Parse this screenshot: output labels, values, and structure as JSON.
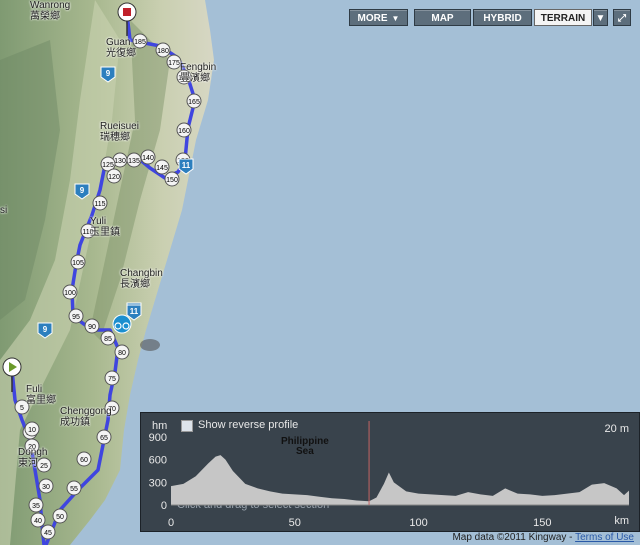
{
  "controls": {
    "more": "MORE",
    "map": "MAP",
    "hybrid": "HYBRID",
    "terrain": "TERRAIN",
    "active": "terrain"
  },
  "places": [
    {
      "id": "wanrong",
      "name": "Wanrong",
      "zh": "萬榮鄉"
    },
    {
      "id": "guanfu",
      "name": "Guan",
      "zh": "光復鄉"
    },
    {
      "id": "fengbin",
      "name": "Fengbin",
      "zh": "豐濱鄉"
    },
    {
      "id": "ruisui",
      "name": "Rueisuei",
      "zh": "瑞穗鄉"
    },
    {
      "id": "yuli",
      "name": "Yuli",
      "zh": "玉里鎮"
    },
    {
      "id": "changbin",
      "name": "Changbin",
      "zh": "長濱鄉"
    },
    {
      "id": "fuli",
      "name": "Fuli",
      "zh": "富里鄉"
    },
    {
      "id": "chenggong",
      "name": "Chenggong",
      "zh": "成功鎮"
    },
    {
      "id": "donghe",
      "name": "Dongh",
      "zh": "東河"
    },
    {
      "id": "edge_si",
      "name": "si",
      "zh": ""
    }
  ],
  "route_markers": [
    "185",
    "180",
    "175",
    "170",
    "165",
    "160",
    "155",
    "150",
    "145",
    "140",
    "135",
    "130",
    "125",
    "120",
    "115",
    "110",
    "105",
    "100",
    "95",
    "90",
    "85",
    "80",
    "75",
    "70",
    "65",
    "60",
    "55",
    "50",
    "45",
    "40",
    "35",
    "30",
    "25",
    "20",
    "15",
    "10",
    "5"
  ],
  "road_shields": [
    "9",
    "9",
    "9",
    "9",
    "11",
    "11"
  ],
  "sea_label": [
    "Philippine",
    "Sea"
  ],
  "elevation": {
    "unit_y": "hm",
    "unit_x": "km",
    "scale_label": "20 m",
    "show_reverse_label": "Show reverse profile",
    "hint": "Click and drag to select section",
    "colors": {
      "fill": "#c6c6c6",
      "bg": "#303840"
    }
  },
  "chart_data": {
    "type": "area",
    "title": "",
    "xlabel": "km",
    "ylabel": "hm",
    "xlim": [
      0,
      185
    ],
    "ylim": [
      0,
      900
    ],
    "x_ticks": [
      0,
      50,
      100,
      150
    ],
    "y_ticks": [
      0,
      300,
      600,
      900
    ],
    "series": [
      {
        "x": [
          0,
          5,
          10,
          15,
          18,
          20,
          22,
          25,
          30,
          35,
          40,
          45,
          50,
          55,
          60,
          65,
          70,
          75,
          80,
          83,
          86,
          88,
          90,
          95,
          100,
          105,
          110,
          115,
          120,
          125,
          130,
          135,
          140,
          145,
          150,
          155,
          160,
          165,
          170,
          175,
          180,
          183,
          185
        ],
        "values": [
          250,
          280,
          380,
          550,
          640,
          660,
          600,
          450,
          280,
          220,
          180,
          150,
          140,
          130,
          110,
          90,
          80,
          60,
          50,
          100,
          280,
          430,
          300,
          180,
          150,
          140,
          130,
          120,
          170,
          140,
          120,
          220,
          150,
          140,
          120,
          130,
          150,
          170,
          270,
          290,
          220,
          130,
          190
        ]
      }
    ]
  },
  "attribution": {
    "text": "Map data ©2011 Kingway - ",
    "terms": "Terms of Use"
  }
}
